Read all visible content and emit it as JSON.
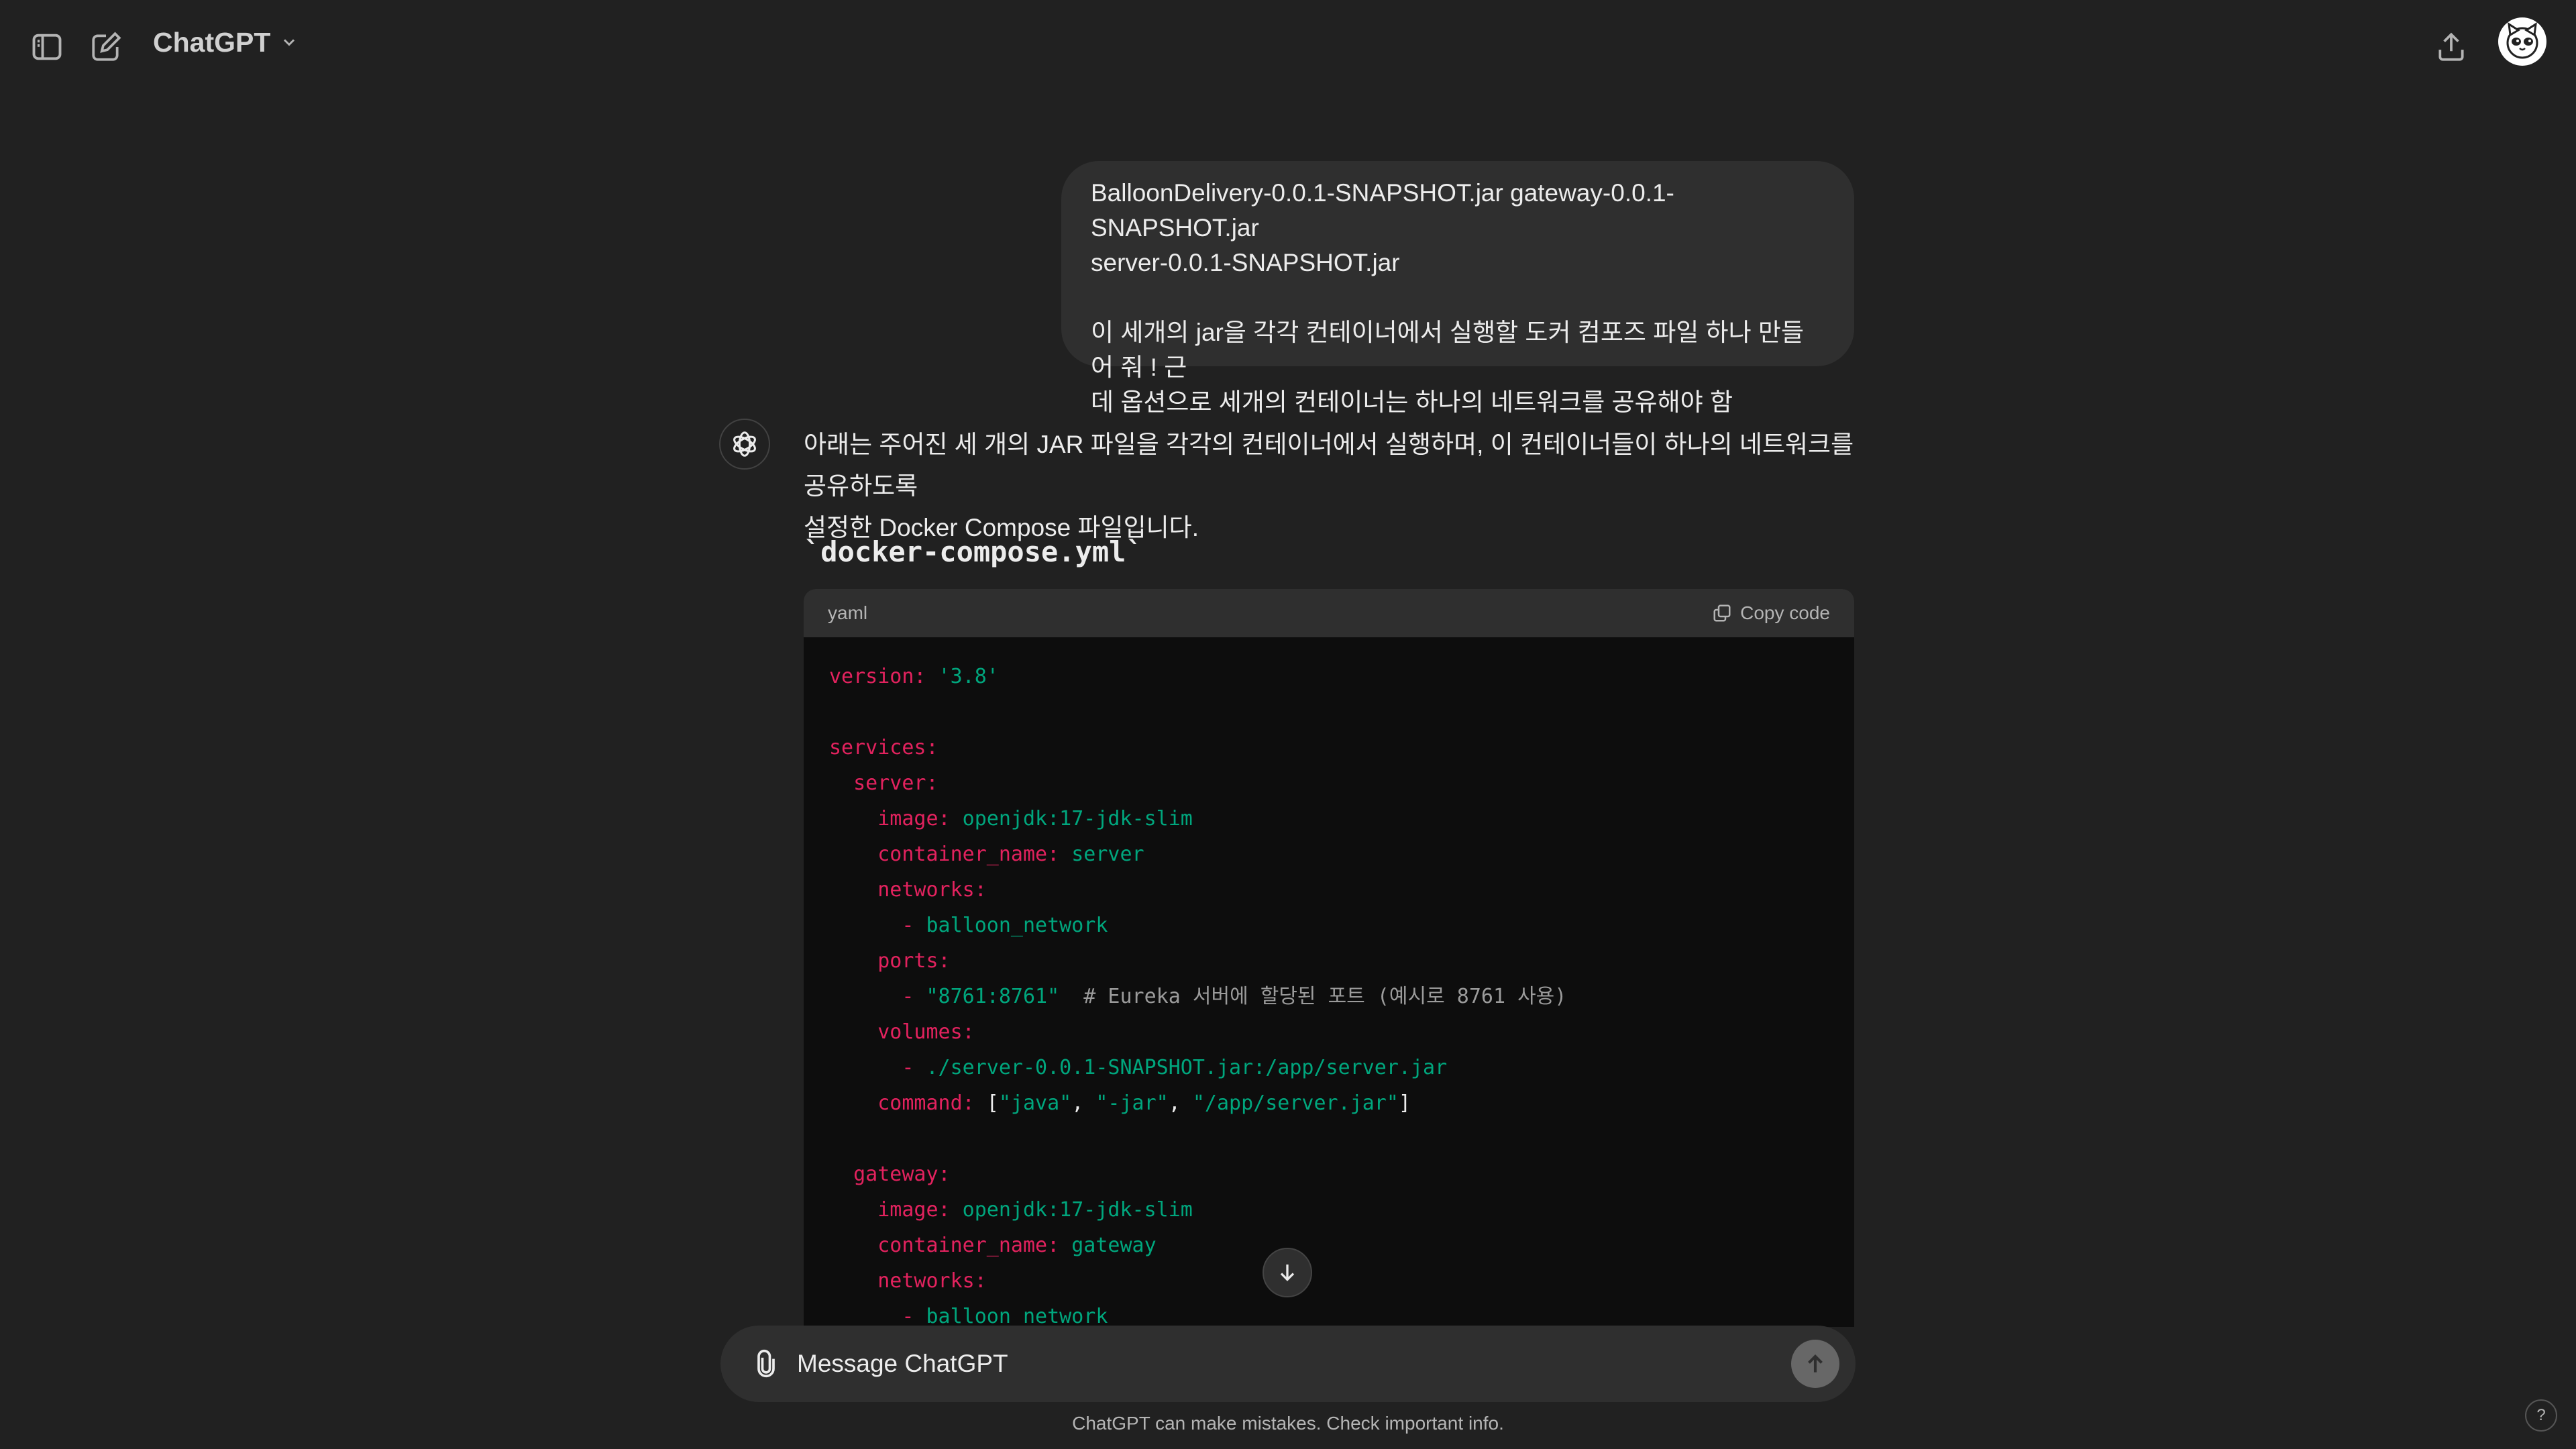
{
  "header": {
    "model_name": "ChatGPT",
    "icons": {
      "sidebar": "sidebar-toggle-icon",
      "new_chat": "compose-icon",
      "share": "share-icon",
      "chevron": "chevron-down-icon"
    }
  },
  "user_message": {
    "line1": "BalloonDelivery-0.0.1-SNAPSHOT.jar  gateway-0.0.1-SNAPSHOT.jar",
    "line2": "server-0.0.1-SNAPSHOT.jar",
    "line3": "이 세개의 jar을 각각 컨테이너에서 실행할 도커 컴포즈 파일 하나 만들어 줘 ! 근",
    "line4": "데 옵션으로 세개의 컨테이너는 하나의 네트워크를 공유해야 함"
  },
  "assistant": {
    "line1": "아래는 주어진 세 개의 JAR 파일을 각각의 컨테이너에서 실행하며, 이 컨테이너들이 하나의 네트워크를 공유하도록",
    "line2": "설정한 Docker Compose 파일입니다.",
    "file_heading": "`docker-compose.yml`",
    "code": {
      "language": "yaml",
      "copy_label": "Copy code",
      "lines": {
        "l1_key": "version:",
        "l1_val": " '3.8'",
        "l3_key": "services:",
        "l4_key": "  server:",
        "l5_key": "    image:",
        "l5_val": " openjdk:17-jdk-slim",
        "l6_key": "    container_name:",
        "l6_val": " server",
        "l7_key": "    networks:",
        "l8_key": "      -",
        "l8_val": " balloon_network",
        "l9_key": "    ports:",
        "l10_key": "      -",
        "l10_val": " \"8761:8761\"",
        "l10_comment": "  # Eureka 서버에 할당된 포트 (예시로 8761 사용)",
        "l11_key": "    volumes:",
        "l12_key": "      -",
        "l12_val": " ./server-0.0.1-SNAPSHOT.jar:/app/server.jar",
        "l13_key": "    command:",
        "l13_a": " [",
        "l13_b": "\"java\"",
        "l13_c": ", ",
        "l13_d": "\"-jar\"",
        "l13_e": ", ",
        "l13_f": "\"/app/server.jar\"",
        "l13_g": "]",
        "l15_key": "  gateway:",
        "l16_key": "    image:",
        "l16_val": " openjdk:17-jdk-slim",
        "l17_key": "    container_name:",
        "l17_val": " gateway",
        "l18_key": "    networks:",
        "l19_key": "      -",
        "l19_val": " balloon_network"
      }
    }
  },
  "composer": {
    "placeholder": "Message ChatGPT"
  },
  "footer": {
    "disclaimer": "ChatGPT can make mistakes. Check important info.",
    "help": "?"
  },
  "colors": {
    "background": "#212121",
    "bubble": "#2f2f2f",
    "code_bg": "#0d0d0d",
    "yaml_key": "#e2225e",
    "yaml_string": "#00a67d"
  }
}
